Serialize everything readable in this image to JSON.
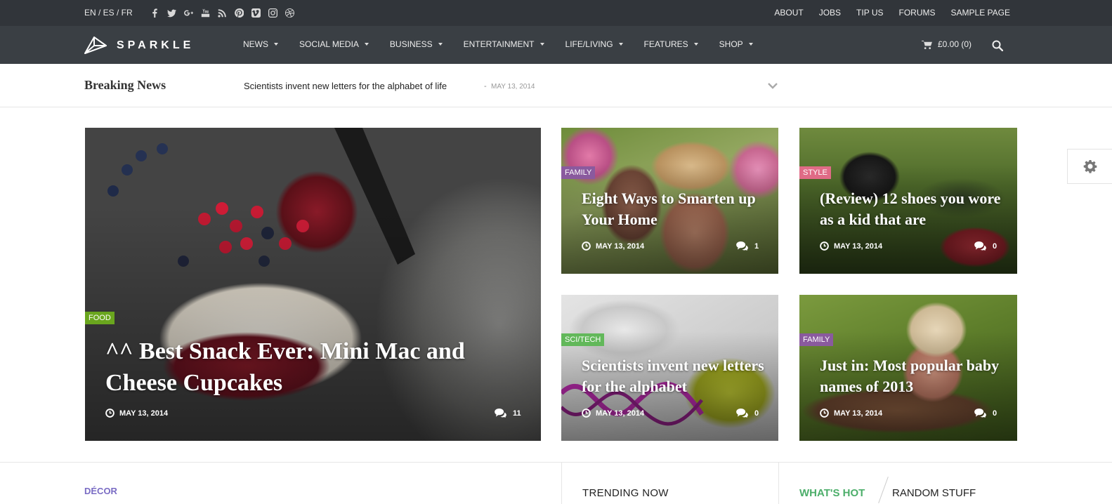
{
  "topbar": {
    "languages": "EN / ES / FR",
    "social_icons": [
      "facebook-icon",
      "twitter-icon",
      "google-plus-icon",
      "youtube-icon",
      "rss-icon",
      "pinterest-icon",
      "vimeo-icon",
      "instagram-icon",
      "dribbble-icon"
    ],
    "links": [
      "ABOUT",
      "JOBS",
      "TIP US",
      "FORUMS",
      "SAMPLE PAGE"
    ]
  },
  "nav": {
    "logo_text": "SPARKLE",
    "menu": [
      "NEWS",
      "SOCIAL MEDIA",
      "BUSINESS",
      "ENTERTAINMENT",
      "LIFE/LIVING",
      "FEATURES",
      "SHOP"
    ],
    "cart": "£0.00 (0)"
  },
  "breaking": {
    "label": "Breaking News",
    "title": "Scientists invent new letters for the alphabet of life",
    "separator": "-",
    "date": "MAY 13, 2014"
  },
  "featured": [
    {
      "category": "FOOD",
      "category_color": "#6aa61e",
      "title": "^^ Best Snack Ever: Mini Mac and Cheese Cupcakes",
      "date": "MAY 13, 2014",
      "comments": "11"
    },
    {
      "category": "FAMILY",
      "category_color": "#8a5a9e",
      "title": "Eight Ways to Smarten up Your Home",
      "date": "MAY 13, 2014",
      "comments": "1"
    },
    {
      "category": "STYLE",
      "category_color": "#e06b86",
      "title": "(Review) 12 shoes you wore as a kid that are",
      "date": "MAY 13, 2014",
      "comments": "0"
    },
    {
      "category": "SCI/TECH",
      "category_color": "#62b85a",
      "title": "Scientists invent new letters for the alphabet",
      "date": "MAY 13, 2014",
      "comments": "0"
    },
    {
      "category": "FAMILY",
      "category_color": "#8a5a9e",
      "title": "Just in: Most popular baby names of 2013",
      "date": "MAY 13, 2014",
      "comments": "0"
    }
  ],
  "sections": {
    "decor": "DÉCOR",
    "trending": "TRENDING NOW",
    "whats_hot": "WHAT'S HOT",
    "random": "RANDOM STUFF"
  }
}
